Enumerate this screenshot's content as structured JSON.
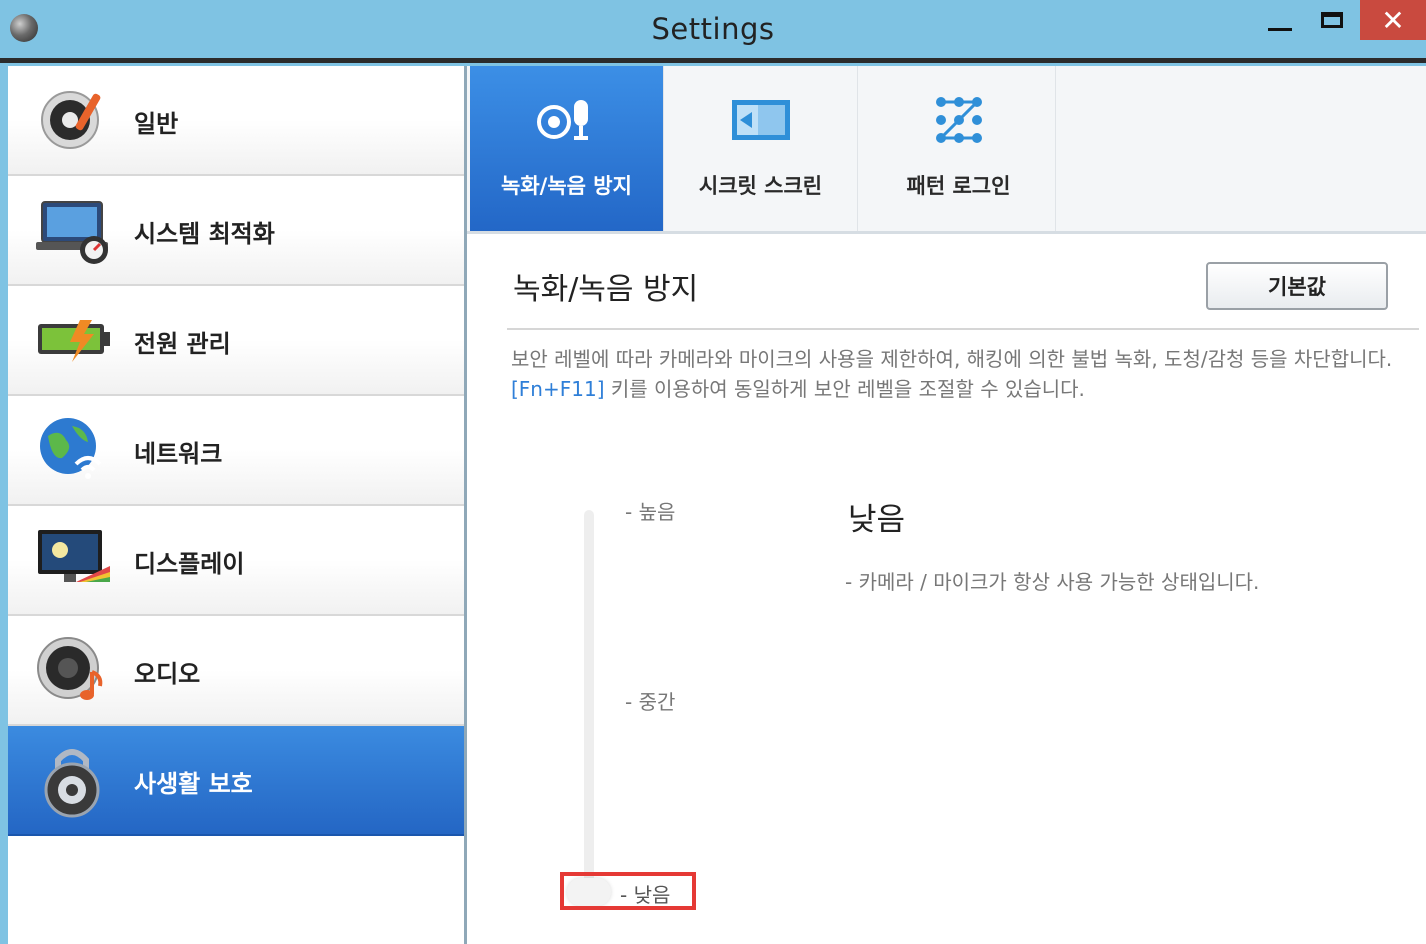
{
  "window": {
    "title": "Settings",
    "minimize_label": "",
    "maximize_label": "",
    "close_label": "✕"
  },
  "sidebar": {
    "items": [
      {
        "label": "일반",
        "icon": "speaker-wrench-icon"
      },
      {
        "label": "시스템 최적화",
        "icon": "laptop-gauge-icon"
      },
      {
        "label": "전원 관리",
        "icon": "battery-icon"
      },
      {
        "label": "네트워크",
        "icon": "globe-wifi-icon"
      },
      {
        "label": "디스플레이",
        "icon": "monitor-color-icon"
      },
      {
        "label": "오디오",
        "icon": "speaker-note-icon"
      },
      {
        "label": "사생활 보호",
        "icon": "padlock-icon",
        "active": true
      }
    ]
  },
  "tabs": [
    {
      "label": "녹화/녹음 방지",
      "icon": "camera-mic-icon",
      "active": true
    },
    {
      "label": "시크릿 스크린",
      "icon": "secret-screen-icon"
    },
    {
      "label": "패턴 로그인",
      "icon": "pattern-grid-icon"
    }
  ],
  "main": {
    "title": "녹화/녹음 방지",
    "default_button": "기본값",
    "description_before": "보안 레벨에 따라 카메라와 마이크의 사용을 제한하여, 해킹에 의한 불법 녹화, 도청/감청 등을 차단합니다. ",
    "description_key": "[Fn+F11]",
    "description_after": " 키를 이용하여 동일하게 보안 레벨을 조절할 수 있습니다.",
    "levels": {
      "high": "- 높음",
      "mid": "- 중간",
      "low": "- 낮음"
    },
    "current_level": "낮음",
    "current_desc": "- 카메라 / 마이크가 항상 사용 가능한 상태입니다."
  },
  "colors": {
    "titlebar": "#7fc3e3",
    "active_blue": "#2466c4",
    "close_red": "#c94a3f",
    "highlight_red": "#e53935",
    "key_blue": "#2f7fd8"
  }
}
